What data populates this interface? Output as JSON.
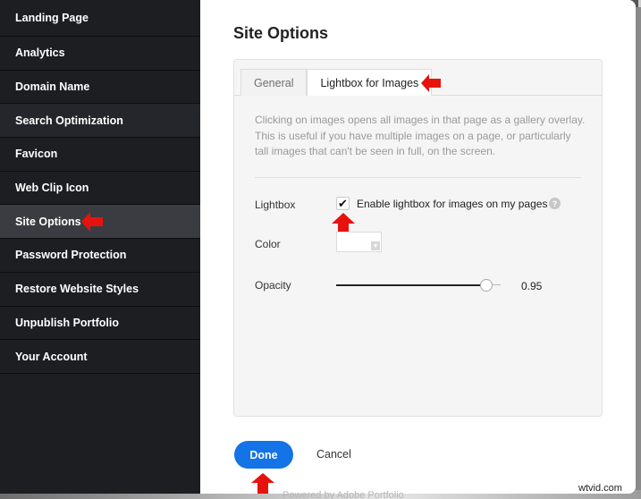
{
  "sidebar": {
    "items": [
      {
        "label": "Landing Page"
      },
      {
        "label": "Analytics"
      },
      {
        "label": "Domain Name"
      },
      {
        "label": "Search Optimization"
      },
      {
        "label": "Favicon"
      },
      {
        "label": "Web Clip Icon"
      },
      {
        "label": "Site Options"
      },
      {
        "label": "Password Protection"
      },
      {
        "label": "Restore Website Styles"
      },
      {
        "label": "Unpublish Portfolio"
      },
      {
        "label": "Your Account"
      }
    ],
    "active_index": 6
  },
  "main": {
    "title": "Site Options",
    "tabs": [
      {
        "label": "General",
        "active": false
      },
      {
        "label": "Lightbox for Images",
        "active": true
      }
    ],
    "description": "Clicking on images opens all images in that page as a gallery overlay. This is useful if you have multiple images on a page, or particularly tall images that can't be seen in full, on the screen.",
    "lightbox": {
      "label": "Lightbox",
      "checkbox_label": "Enable lightbox for images on my pages",
      "checked": true,
      "help_icon": "?"
    },
    "color": {
      "label": "Color",
      "value": "#ffffff"
    },
    "opacity": {
      "label": "Opacity",
      "value": "0.95",
      "fraction": 0.95
    },
    "done_label": "Done",
    "cancel_label": "Cancel"
  },
  "footer": {
    "powered_by": "Powered by Adobe Portfolio"
  },
  "watermark": "wtvid.com",
  "colors": {
    "accent": "#1473e6",
    "sidebar_bg": "#1c1e22",
    "annotation_arrow": "#e8120c"
  }
}
